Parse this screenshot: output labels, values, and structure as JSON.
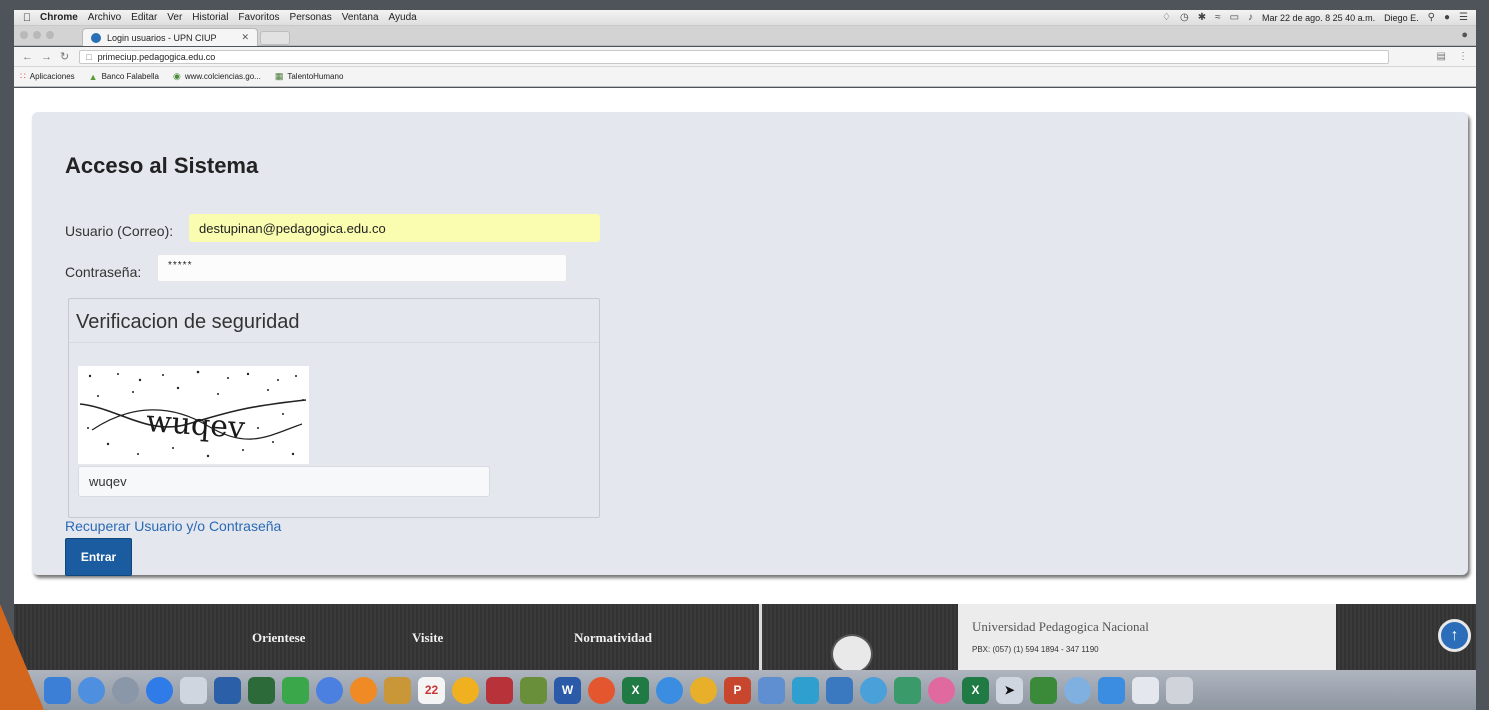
{
  "menubar": {
    "items": [
      "Chrome",
      "Archivo",
      "Editar",
      "Ver",
      "Historial",
      "Favoritos",
      "Personas",
      "Ventana",
      "Ayuda"
    ],
    "clock": "Mar 22 de ago. 8 25 40 a.m.",
    "user": "Diego E."
  },
  "browser": {
    "tab_title": "Login usuarios - UPN CIUP",
    "url": "primeciup.pedagogica.edu.co",
    "bookmarks": [
      "Aplicaciones",
      "Banco Falabella",
      "www.colciencias.go...",
      "TalentoHumano"
    ]
  },
  "login": {
    "title": "Acceso al Sistema",
    "user_label": "Usuario (Correo):",
    "user_value": "destupinan@pedagogica.edu.co",
    "password_label": "Contraseña:",
    "password_value": "*****",
    "captcha_legend": "Verificacion de seguridad",
    "captcha_text": "wuqev",
    "captcha_input_value": "wuqev",
    "recover_link": "Recuperar Usuario y/o Contraseña",
    "submit_label": "Entrar"
  },
  "footer": {
    "col1": "Orientese",
    "col2": "Visite",
    "col3": "Normatividad",
    "university": "Universidad Pedagogica Nacional",
    "phone": "PBX: (057) (1) 594 1894 - 347 1190"
  },
  "colors": {
    "panel_bg": "#e4e7ee",
    "autofill_yellow": "#fafdb0",
    "button_blue": "#1a5c9f",
    "link_blue": "#2a6ab5"
  }
}
